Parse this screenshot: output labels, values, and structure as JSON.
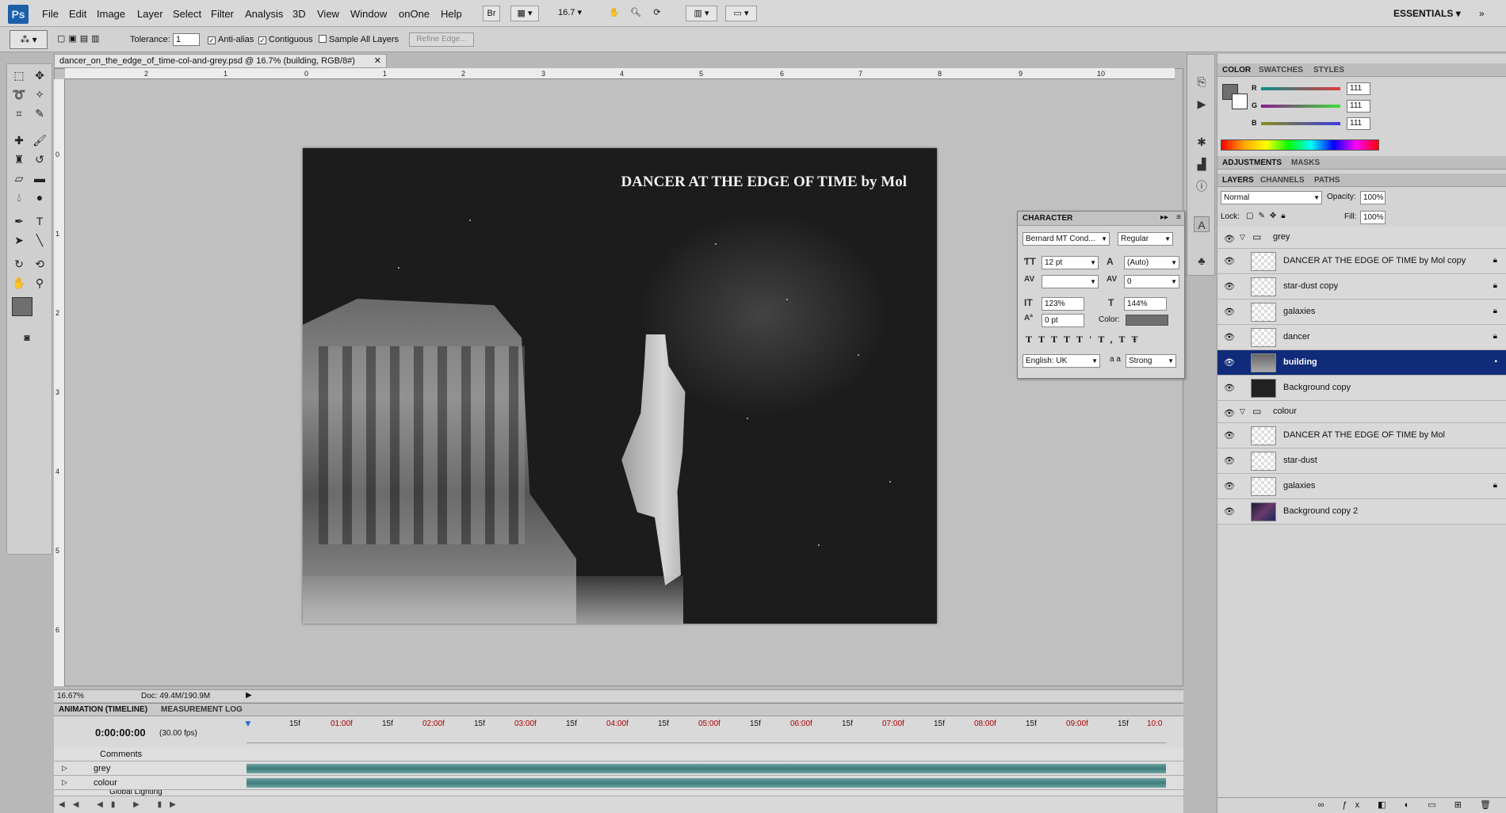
{
  "app": {
    "logo": "Ps",
    "workspace": "ESSENTIALS",
    "zoom_select": "16.7"
  },
  "menu": [
    "File",
    "Edit",
    "Image",
    "Layer",
    "Select",
    "Filter",
    "Analysis",
    "3D",
    "View",
    "Window",
    "onOne",
    "Help"
  ],
  "menubar_buttons": {
    "bridge": "Br"
  },
  "options": {
    "tolerance_label": "Tolerance:",
    "tolerance_value": "1",
    "antialias": "Anti-alias",
    "contiguous": "Contiguous",
    "sample_all": "Sample All Layers",
    "refine_edge": "Refine Edge..."
  },
  "document": {
    "tab_title": "dancer_on_the_edge_of_time-col-and-grey.psd @ 16.7% (building, RGB/8#)",
    "canvas_title": "DANCER AT THE EDGE OF TIME by Mol",
    "ruler_top": [
      "2",
      "1",
      "0",
      "1",
      "2",
      "3",
      "4",
      "5",
      "6",
      "7",
      "8",
      "9",
      "10"
    ],
    "ruler_left": [
      "0",
      "1",
      "2",
      "3",
      "4",
      "5",
      "6"
    ]
  },
  "status": {
    "zoom": "16.67%",
    "doc": "Doc: 49.4M/190.9M"
  },
  "animation": {
    "tabs": [
      "ANIMATION (TIMELINE)",
      "MEASUREMENT LOG"
    ],
    "time": "0:00:00:00",
    "fps": "(30.00 fps)",
    "markers": [
      "15f",
      "01:00f",
      "15f",
      "02:00f",
      "15f",
      "03:00f",
      "15f",
      "04:00f",
      "15f",
      "05:00f",
      "15f",
      "06:00f",
      "15f",
      "07:00f",
      "15f",
      "08:00f",
      "15f",
      "09:00f",
      "15f",
      "10:0"
    ],
    "rows": [
      "Comments",
      "grey",
      "colour",
      "Global Lighting"
    ]
  },
  "color_panel": {
    "tabs": [
      "COLOR",
      "SWATCHES",
      "STYLES"
    ],
    "channels": [
      {
        "label": "R",
        "value": "111"
      },
      {
        "label": "G",
        "value": "111"
      },
      {
        "label": "B",
        "value": "111"
      }
    ]
  },
  "adjust_tabs": [
    "ADJUSTMENTS",
    "MASKS"
  ],
  "layers_panel": {
    "tabs": [
      "LAYERS",
      "CHANNELS",
      "PATHS"
    ],
    "blend_mode": "Normal",
    "opacity_label": "Opacity:",
    "opacity": "100%",
    "lock_label": "Lock:",
    "fill_label": "Fill:",
    "fill": "100%",
    "groups": [
      {
        "name": "grey",
        "layers": [
          {
            "name": "DANCER AT THE EDGE OF TIME by Mol copy",
            "locked": true,
            "selected": false
          },
          {
            "name": "star-dust copy",
            "locked": true,
            "selected": false
          },
          {
            "name": "galaxies",
            "locked": true,
            "selected": false
          },
          {
            "name": "dancer",
            "locked": true,
            "selected": false
          },
          {
            "name": "building",
            "locked": false,
            "selected": true
          },
          {
            "name": "Background copy",
            "locked": false,
            "selected": false
          }
        ]
      },
      {
        "name": "colour",
        "layers": [
          {
            "name": "DANCER AT THE EDGE OF TIME by Mol",
            "locked": false,
            "selected": false
          },
          {
            "name": "star-dust",
            "locked": false,
            "selected": false
          },
          {
            "name": "galaxies",
            "locked": true,
            "selected": false
          },
          {
            "name": "Background copy 2",
            "locked": false,
            "selected": false
          }
        ]
      }
    ]
  },
  "character_panel": {
    "title": "CHARACTER",
    "font": "Bernard MT Cond...",
    "style": "Regular",
    "size": "12 pt",
    "leading": "(Auto)",
    "kerning": "",
    "tracking": "0",
    "vscale": "123%",
    "hscale": "144%",
    "baseline": "0 pt",
    "color_label": "Color:",
    "language": "English: UK",
    "aa_label": "a a",
    "antialias": "Strong"
  }
}
